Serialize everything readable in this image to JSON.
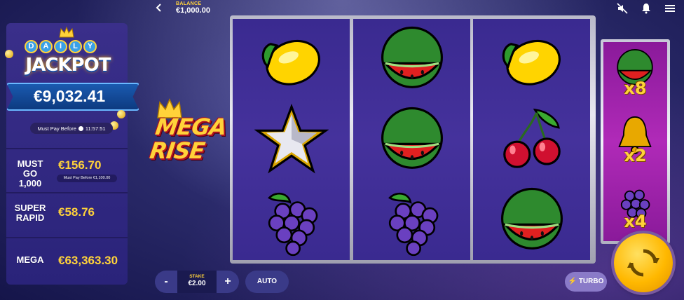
{
  "topbar": {
    "balance_label": "BALANCE",
    "balance_value": "€1,000.00"
  },
  "jackpots": {
    "daily_letters": [
      "D",
      "A",
      "I",
      "L",
      "Y"
    ],
    "daily_title": "JACKPOT",
    "daily_amount": "€9,032.41",
    "daily_must_pay_label": "Must Pay Before",
    "daily_must_pay_time": "11:57:51",
    "rows": [
      {
        "name_line1": "MUST GO",
        "name_line2": "1,000",
        "amount": "€156.70",
        "sub": "Must Pay Before €1,100.00"
      },
      {
        "name_line1": "SUPER",
        "name_line2": "RAPID",
        "amount": "€58.76",
        "sub": ""
      },
      {
        "name_line1": "MEGA",
        "name_line2": "",
        "amount": "€63,363.30",
        "sub": ""
      }
    ]
  },
  "mega_rise": {
    "line1": "MEGA",
    "line2": "RISE"
  },
  "reels": [
    [
      "lemon",
      "star",
      "grapes"
    ],
    [
      "watermelon",
      "watermelon",
      "grapes"
    ],
    [
      "lemon",
      "cherries",
      "watermelon"
    ]
  ],
  "multipliers": [
    {
      "symbol": "watermelon",
      "label": "x8"
    },
    {
      "symbol": "bell",
      "label": "x2"
    },
    {
      "symbol": "grapes",
      "label": "x4"
    }
  ],
  "controls": {
    "minus": "-",
    "plus": "+",
    "stake_label": "STAKE",
    "stake_value": "€2.00",
    "auto_label": "AUTO",
    "turbo_label": "TURBO"
  },
  "colors": {
    "accent_gold": "#ffd23a",
    "panel": "#3a2f8a",
    "reel_bg": "#45329c",
    "multiplier_bg": "#b02ab8"
  }
}
